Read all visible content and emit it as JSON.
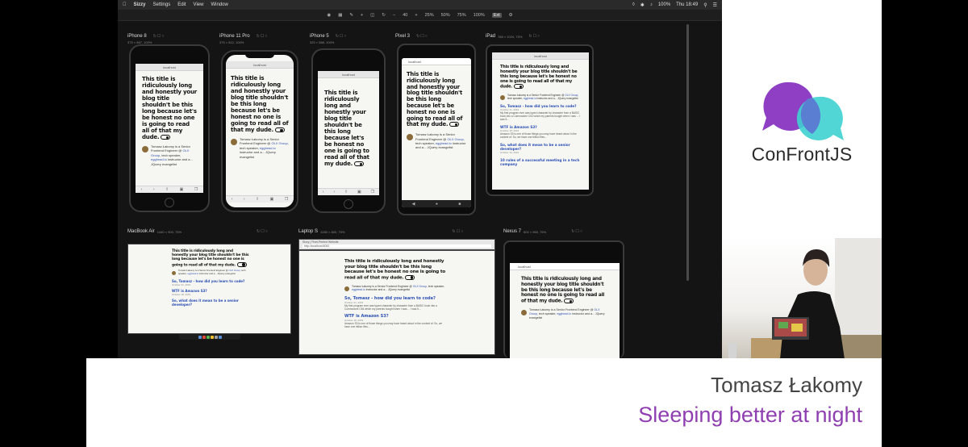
{
  "menubar": {
    "app": "Sizzy",
    "items": [
      "Settings",
      "Edit",
      "View",
      "Window"
    ],
    "battery": "100%",
    "clock": "Thu 18:49"
  },
  "toolbar": {
    "zoom_value": "40",
    "zoom_presets": [
      "25%",
      "50%",
      "75%",
      "100%"
    ],
    "mode_badge": "Ext"
  },
  "url": "localhost",
  "blog": {
    "title": "This title is ridiculously long and honestly your blog title shouldn't be this long because let's be honest no one is going to read all of that my dude.",
    "bio_line1": "Tomasz Łakomy is a Senior Frontend Engineer @",
    "bio_company": "OLX Group",
    "bio_line2": ", tech speaker,",
    "bio_link2": "egghead.io",
    "bio_line3": " instructor and a... JQuery evangelist",
    "posts": [
      {
        "title": "So, Tomasz - how did you learn to code?",
        "date": "October 21, 2019",
        "text": "My first program ever was typed character by character from a BASIC book into a Commodore C64 which my parents bought when I was ... I was 5..."
      },
      {
        "title": "WTF is Amazon S3?",
        "date": "October 18, 2019",
        "text": "Amazon S3 is one of those things you may have heard about in the context of: So, we have one trillion files..."
      },
      {
        "title": "So, what does it mean to be a senior developer?",
        "date": "October 13, 2019",
        "text": "Tiled page: I have to. Why did everything have to change?"
      },
      {
        "title": "10 rules of a successful meeting in a tech company",
        "date": "",
        "text": ""
      }
    ]
  },
  "devices": [
    {
      "name": "iPhone 8",
      "dims": "375 × 667, 100%"
    },
    {
      "name": "iPhone 11 Pro",
      "dims": "375 × 812, 100%"
    },
    {
      "name": "iPhone 5",
      "dims": "320 × 568, 100%"
    },
    {
      "name": "Pixel 3",
      "dims": "393 × 786, 100%"
    },
    {
      "name": "iPad",
      "dims": "768 × 1024, 75%"
    },
    {
      "name": "MacBook Air",
      "dims": "1440 × 900, 75%"
    },
    {
      "name": "Laptop S",
      "dims": "1280 × 800, 75%"
    },
    {
      "name": "Nexus 7",
      "dims": "600 × 960, 75%"
    }
  ],
  "laptop_tab": "Sizzy | Pixel-Perfect Website",
  "laptop_url": "http://localhost:8000",
  "brand": {
    "name": "ConFrontJS",
    "purple": "#8e3fc4",
    "teal": "#3fd1d0"
  },
  "lower_third": {
    "speaker": "Tomasz Łakomy",
    "talk": "Sleeping better at night",
    "accent": "#8f3fb0"
  }
}
